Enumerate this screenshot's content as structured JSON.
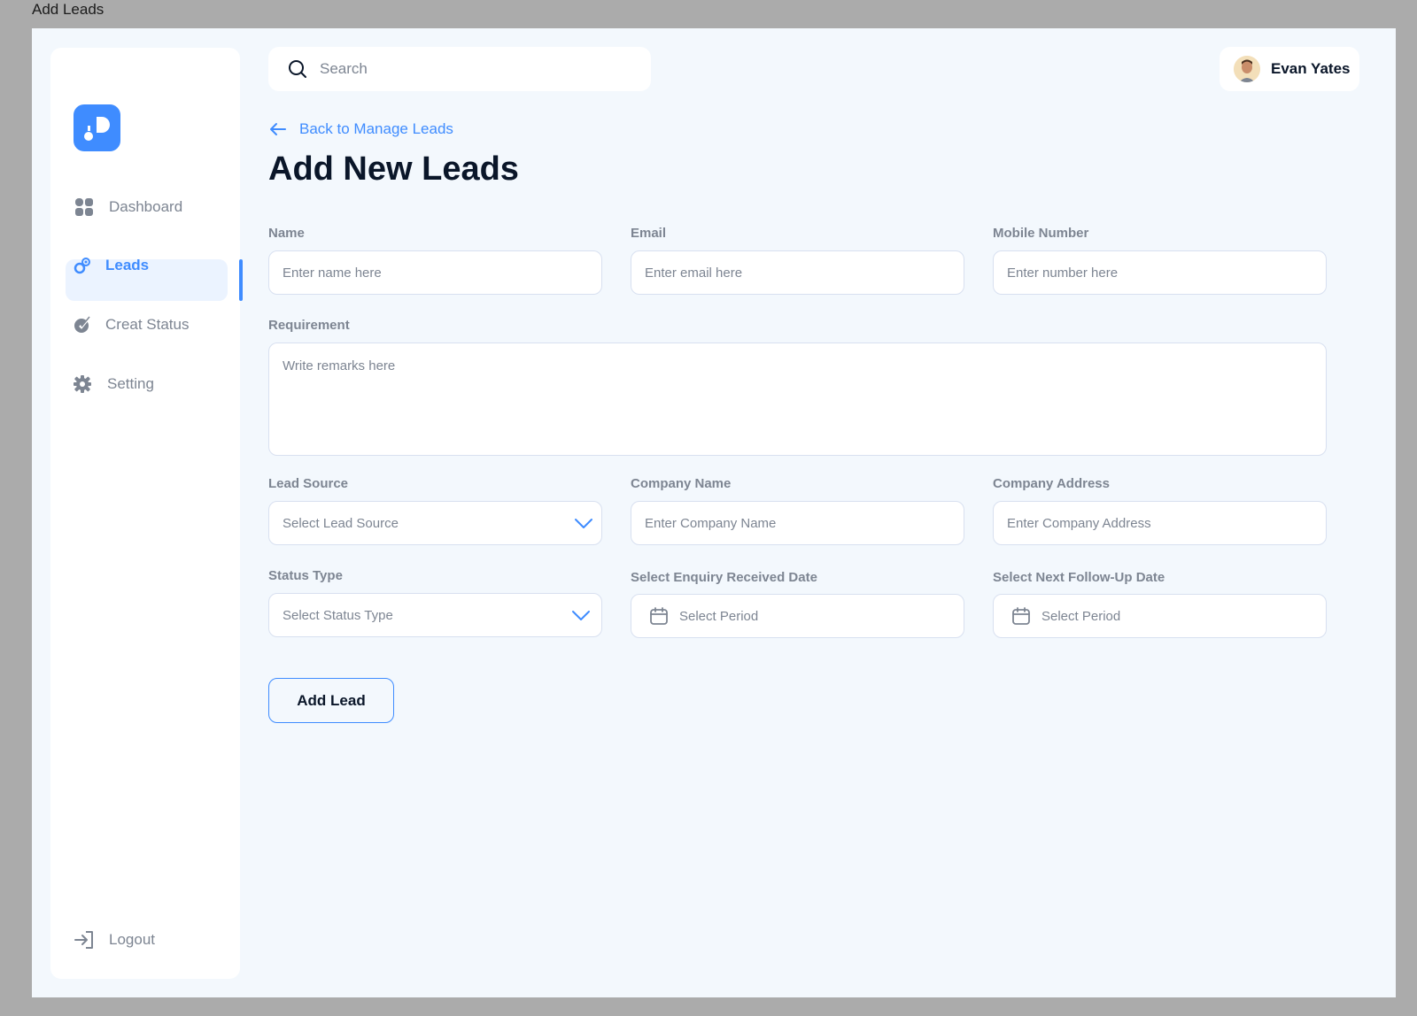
{
  "window": {
    "title": "Add Leads"
  },
  "sidebar": {
    "items": [
      {
        "label": "Dashboard",
        "icon": "dashboard-icon"
      },
      {
        "label": "Leads",
        "icon": "leads-icon",
        "active": true
      },
      {
        "label": "Creat Status",
        "icon": "status-icon"
      },
      {
        "label": "Setting",
        "icon": "gear-icon"
      }
    ],
    "logout": {
      "label": "Logout",
      "icon": "logout-icon"
    }
  },
  "header": {
    "search": {
      "placeholder": "Search",
      "icon": "search-icon"
    },
    "user": {
      "name": "Evan Yates"
    }
  },
  "page": {
    "back_link": "Back to Manage Leads",
    "title": "Add New Leads"
  },
  "form": {
    "name": {
      "label": "Name",
      "placeholder": "Enter name here"
    },
    "email": {
      "label": "Email",
      "placeholder": "Enter email here"
    },
    "mobile": {
      "label": "Mobile Number",
      "placeholder": "Enter number here"
    },
    "requirement": {
      "label": "Requirement",
      "placeholder": "Write remarks here"
    },
    "lead_source": {
      "label": "Lead Source",
      "placeholder": "Select Lead Source"
    },
    "company_name": {
      "label": "Company Name",
      "placeholder": "Enter Company Name"
    },
    "company_address": {
      "label": "Company Address",
      "placeholder": "Enter Company Address"
    },
    "status_type": {
      "label": "Status Type",
      "placeholder": "Select Status Type"
    },
    "enquiry_date": {
      "label": "Select Enquiry Received Date",
      "placeholder": "Select Period"
    },
    "followup_date": {
      "label": "Select Next Follow-Up Date",
      "placeholder": "Select Period"
    },
    "submit_label": "Add Lead"
  },
  "colors": {
    "accent": "#3f8cff",
    "background": "#f3f8fd",
    "text_primary": "#0a1629",
    "text_muted": "#7d8592"
  }
}
